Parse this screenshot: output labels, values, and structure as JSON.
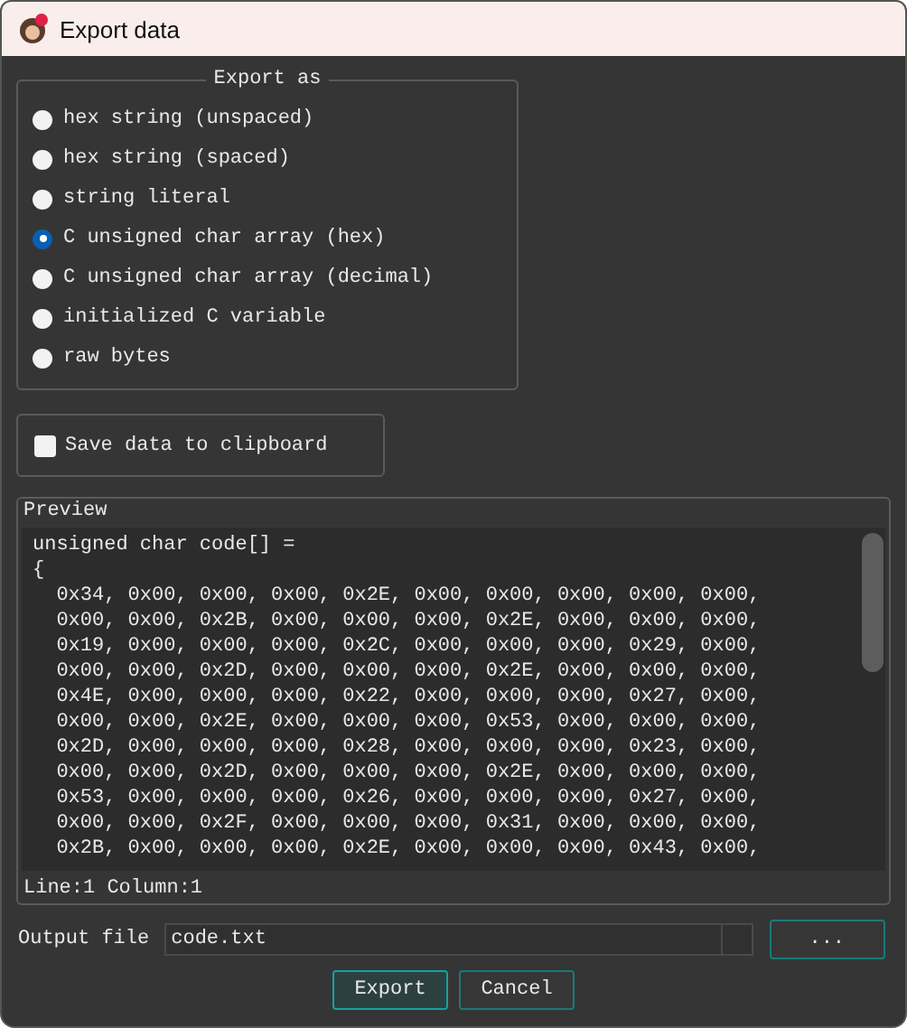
{
  "window": {
    "title": "Export data"
  },
  "export_as": {
    "title": "Export as",
    "options": [
      {
        "label": "hex string (unspaced)",
        "selected": false
      },
      {
        "label": "hex string (spaced)",
        "selected": false
      },
      {
        "label": "string literal",
        "selected": false
      },
      {
        "label": "C unsigned char array (hex)",
        "selected": true
      },
      {
        "label": "C unsigned char array (decimal)",
        "selected": false
      },
      {
        "label": "initialized C variable",
        "selected": false
      },
      {
        "label": "raw bytes",
        "selected": false
      }
    ]
  },
  "clipboard": {
    "label": "Save data to clipboard",
    "checked": false
  },
  "preview": {
    "title": "Preview",
    "lines": [
      "unsigned char code[] =",
      "{",
      "  0x34, 0x00, 0x00, 0x00, 0x2E, 0x00, 0x00, 0x00, 0x00, 0x00,",
      "  0x00, 0x00, 0x2B, 0x00, 0x00, 0x00, 0x2E, 0x00, 0x00, 0x00,",
      "  0x19, 0x00, 0x00, 0x00, 0x2C, 0x00, 0x00, 0x00, 0x29, 0x00,",
      "  0x00, 0x00, 0x2D, 0x00, 0x00, 0x00, 0x2E, 0x00, 0x00, 0x00,",
      "  0x4E, 0x00, 0x00, 0x00, 0x22, 0x00, 0x00, 0x00, 0x27, 0x00,",
      "  0x00, 0x00, 0x2E, 0x00, 0x00, 0x00, 0x53, 0x00, 0x00, 0x00,",
      "  0x2D, 0x00, 0x00, 0x00, 0x28, 0x00, 0x00, 0x00, 0x23, 0x00,",
      "  0x00, 0x00, 0x2D, 0x00, 0x00, 0x00, 0x2E, 0x00, 0x00, 0x00,",
      "  0x53, 0x00, 0x00, 0x00, 0x26, 0x00, 0x00, 0x00, 0x27, 0x00,",
      "  0x00, 0x00, 0x2F, 0x00, 0x00, 0x00, 0x31, 0x00, 0x00, 0x00,",
      "  0x2B, 0x00, 0x00, 0x00, 0x2E, 0x00, 0x00, 0x00, 0x43, 0x00,"
    ],
    "status": "Line:1  Column:1"
  },
  "output_file": {
    "label": "Output file",
    "value": "code.txt",
    "browse": "..."
  },
  "buttons": [
    "Export",
    "Cancel"
  ]
}
